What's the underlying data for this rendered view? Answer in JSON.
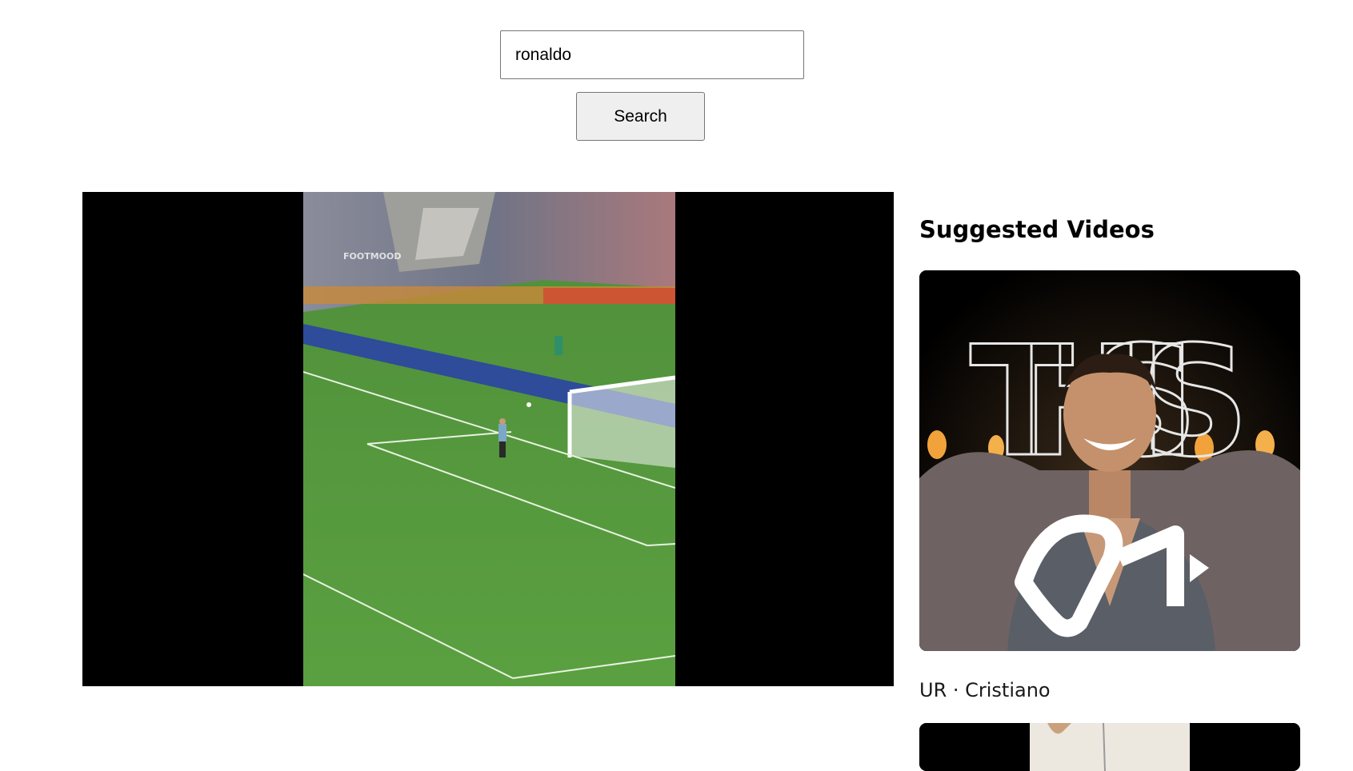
{
  "search": {
    "value": "ronaldo",
    "button_label": "Search"
  },
  "player": {
    "frame_watermark": "FOOTMOOD"
  },
  "sidebar": {
    "title": "Suggested Videos",
    "videos": [
      {
        "thumbnail_text": "THIS IS",
        "thumbnail_logo": "UR",
        "title": "UR · Cristiano"
      },
      {
        "thumbnail_text": "",
        "thumbnail_logo": "",
        "title": ""
      }
    ]
  }
}
